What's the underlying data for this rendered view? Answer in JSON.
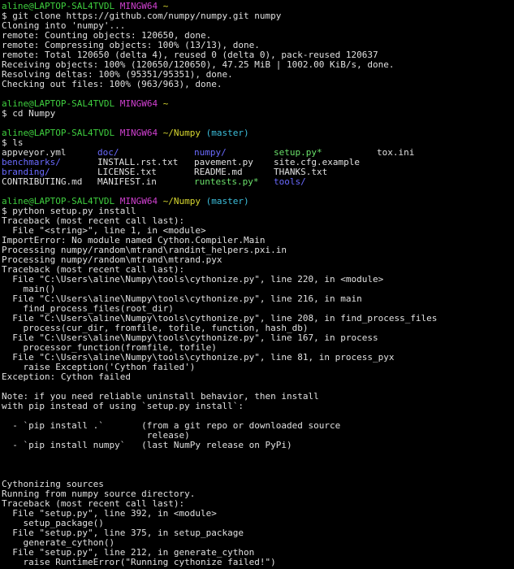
{
  "prompt": {
    "user_host": "aline@LAPTOP-SAL4TVDL",
    "shell": "MINGW64",
    "home_path": "~",
    "repo_path": "~/Numpy",
    "branch": "(master)",
    "symbol": "$"
  },
  "commands": {
    "clone": "git clone https://github.com/numpy/numpy.git numpy",
    "cd": "cd Numpy",
    "ls": "ls",
    "install": "python setup.py install"
  },
  "clone_output": [
    "Cloning into 'numpy'...",
    "remote: Counting objects: 120650, done.",
    "remote: Compressing objects: 100% (13/13), done.",
    "remote: Total 120650 (delta 4), reused 0 (delta 0), pack-reused 120637",
    "Receiving objects: 100% (120650/120650), 47.25 MiB | 1002.00 KiB/s, done.",
    "Resolving deltas: 100% (95351/95351), done.",
    "Checking out files: 100% (963/963), done."
  ],
  "ls_listing": {
    "row1": [
      "appveyor.yml",
      "doc/",
      "numpy/",
      "setup.py*",
      "tox.ini"
    ],
    "row2": [
      "benchmarks/",
      "INSTALL.rst.txt",
      "pavement.py",
      "site.cfg.example"
    ],
    "row3": [
      "branding/",
      "LICENSE.txt",
      "README.md",
      "THANKS.txt"
    ],
    "row4": [
      "CONTRIBUTING.md",
      "MANIFEST.in",
      "runtests.py*",
      "tools/"
    ]
  },
  "colors": {
    "background": "#000000",
    "text": "#e0e0e0",
    "prompt_user": "#3fcf3f",
    "prompt_shell": "#d040d0",
    "prompt_path": "#d8d830",
    "prompt_branch": "#40b0d8",
    "directory": "#6a6aff",
    "executable": "#6be06b"
  },
  "install_output": [
    "Traceback (most recent call last):",
    "  File \"<string>\", line 1, in <module>",
    "ImportError: No module named Cython.Compiler.Main",
    "Processing numpy/random\\mtrand\\randint_helpers.pxi.in",
    "Processing numpy/random\\mtrand\\mtrand.pyx",
    "Traceback (most recent call last):",
    "  File \"C:\\Users\\aline\\Numpy\\tools\\cythonize.py\", line 220, in <module>",
    "    main()",
    "  File \"C:\\Users\\aline\\Numpy\\tools\\cythonize.py\", line 216, in main",
    "    find_process_files(root_dir)",
    "  File \"C:\\Users\\aline\\Numpy\\tools\\cythonize.py\", line 208, in find_process_files",
    "    process(cur_dir, fromfile, tofile, function, hash_db)",
    "  File \"C:\\Users\\aline\\Numpy\\tools\\cythonize.py\", line 167, in process",
    "    processor_function(fromfile, tofile)",
    "  File \"C:\\Users\\aline\\Numpy\\tools\\cythonize.py\", line 81, in process_pyx",
    "    raise Exception('Cython failed')",
    "Exception: Cython failed",
    "",
    "Note: if you need reliable uninstall behavior, then install",
    "with pip instead of using `setup.py install`:",
    "",
    "  - `pip install .`       (from a git repo or downloaded source",
    "                           release)",
    "  - `pip install numpy`   (last NumPy release on PyPi)",
    "",
    "",
    "",
    "Cythonizing sources",
    "Running from numpy source directory.",
    "Traceback (most recent call last):",
    "  File \"setup.py\", line 392, in <module>",
    "    setup_package()",
    "  File \"setup.py\", line 375, in setup_package",
    "    generate_cython()",
    "  File \"setup.py\", line 212, in generate_cython",
    "    raise RuntimeError(\"Running cythonize failed!\")"
  ]
}
